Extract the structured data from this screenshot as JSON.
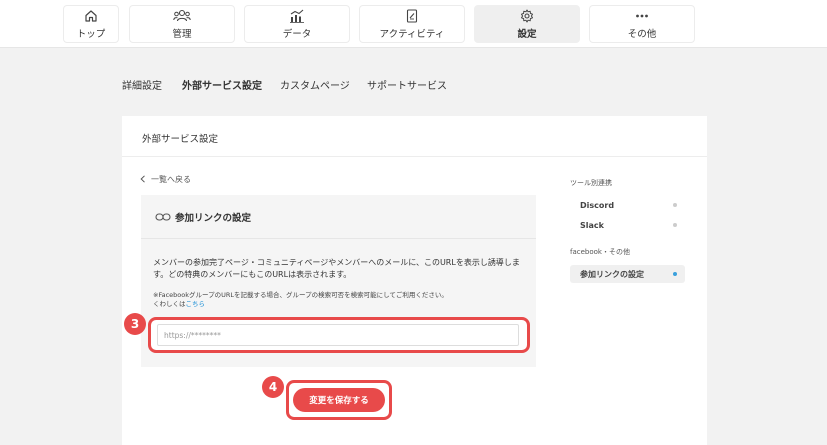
{
  "nav": {
    "items": [
      {
        "label": "トップ",
        "icon": "home-icon"
      },
      {
        "label": "管理",
        "icon": "users-icon"
      },
      {
        "label": "データ",
        "icon": "chart-icon"
      },
      {
        "label": "アクティビティ",
        "icon": "document-icon"
      },
      {
        "label": "設定",
        "icon": "gear-icon",
        "active": true
      },
      {
        "label": "その他",
        "icon": "more-icon"
      }
    ]
  },
  "subtabs": [
    {
      "label": "詳細設定"
    },
    {
      "label": "外部サービス設定",
      "active": true
    },
    {
      "label": "カスタムページ"
    },
    {
      "label": "サポートサービス"
    }
  ],
  "card": {
    "title": "外部サービス設定",
    "back_label": "一覧へ戻る",
    "panel": {
      "title": "参加リンクの設定",
      "description": "メンバーの参加完了ページ・コミュニティページやメンバーへのメールに、このURLを表示し誘導します。どの特典のメンバーにもこのURLは表示されます。",
      "note_line1": "※FacebookグループのURLを記載する場合、グループの検索可否を検索可能にしてご利用ください。",
      "note_line2_prefix": "くわしくは",
      "note_link": "こちら",
      "input_placeholder": "https://********"
    },
    "save_label": "変更を保存する"
  },
  "badges": {
    "input_step": "3",
    "save_step": "4"
  },
  "sidebar": {
    "section1": "ツール別連携",
    "section1_items": [
      {
        "label": "Discord"
      },
      {
        "label": "Slack"
      }
    ],
    "section2": "facebook・その他",
    "section2_items": [
      {
        "label": "参加リンクの設定",
        "active": true
      }
    ]
  },
  "colors": {
    "accent": "#e84a4a",
    "link": "#1a8fd6",
    "active_dot": "#3aa0dc"
  }
}
